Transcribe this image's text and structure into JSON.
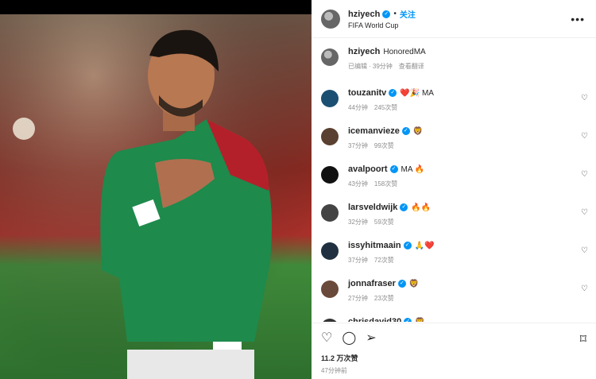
{
  "post": {
    "username": "hziyech",
    "follow_label": "关注",
    "location": "FIFA World Cup",
    "caption": {
      "username": "hziyech",
      "text": "HonoredMA",
      "meta": [
        "已编辑",
        "· 39分钟",
        "查看翻译"
      ]
    }
  },
  "comments": [
    {
      "user": "touzanitv",
      "text": "❤️🎉 MA",
      "time": "44分钟",
      "likes": "245次赞",
      "avatar_color": "#1b4f72"
    },
    {
      "user": "icemanvieze",
      "text": "🦁",
      "time": "37分钟",
      "likes": "99次赞",
      "avatar_color": "#5a4030"
    },
    {
      "user": "avalpoort",
      "text": "MA 🔥",
      "time": "43分钟",
      "likes": "158次赞",
      "avatar_color": "#111111"
    },
    {
      "user": "larsveldwijk",
      "text": "🔥🔥",
      "time": "32分钟",
      "likes": "59次赞",
      "avatar_color": "#444444"
    },
    {
      "user": "issyhitmaain",
      "text": "🙏❤️",
      "time": "37分钟",
      "likes": "72次赞",
      "avatar_color": "#203040"
    },
    {
      "user": "jonnafraser",
      "text": "🦁",
      "time": "27分钟",
      "likes": "23次赞",
      "avatar_color": "#6a4a3a"
    },
    {
      "user": "chrisdavid30",
      "text": "🦁",
      "time": "",
      "likes": "",
      "avatar_color": "#333333"
    }
  ],
  "footer": {
    "likes": "11.2 万次赞",
    "time": "47分钟前"
  },
  "icons": {
    "like": "heart-icon",
    "comment": "comment-icon",
    "share": "share-icon",
    "save": "bookmark-icon",
    "more": "more-icon"
  },
  "colors": {
    "accent": "#0095f6",
    "jersey_green": "#1e8a4c",
    "jersey_red": "#b4202a"
  }
}
